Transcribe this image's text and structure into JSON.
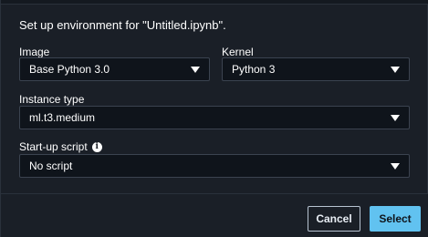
{
  "dialog": {
    "description": "Set up environment for \"Untitled.ipynb\"."
  },
  "fields": {
    "image": {
      "label": "Image",
      "value": "Base Python 3.0"
    },
    "kernel": {
      "label": "Kernel",
      "value": "Python 3"
    },
    "instance_type": {
      "label": "Instance type",
      "value": "ml.t3.medium"
    },
    "startup_script": {
      "label": "Start-up script",
      "value": "No script",
      "info_icon": "info-icon"
    }
  },
  "buttons": {
    "cancel": "Cancel",
    "select": "Select"
  },
  "colors": {
    "background": "#1a1f27",
    "input_background": "#0f141b",
    "accent": "#61c2f0"
  }
}
